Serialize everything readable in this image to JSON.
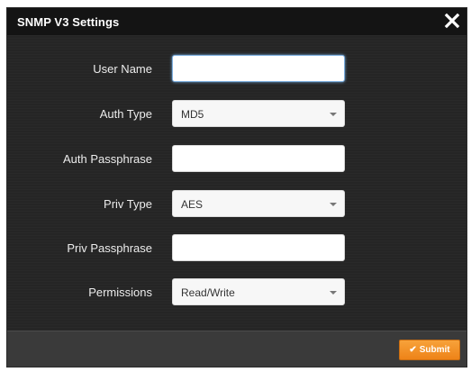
{
  "dialog": {
    "title": "SNMP V3 Settings",
    "close_icon": "close-icon"
  },
  "form": {
    "user_name": {
      "label": "User Name",
      "value": ""
    },
    "auth_type": {
      "label": "Auth Type",
      "value": "MD5"
    },
    "auth_passphrase": {
      "label": "Auth Passphrase",
      "value": ""
    },
    "priv_type": {
      "label": "Priv Type",
      "value": "AES"
    },
    "priv_passphrase": {
      "label": "Priv Passphrase",
      "value": ""
    },
    "permissions": {
      "label": "Permissions",
      "value": "Read/Write"
    }
  },
  "footer": {
    "submit_label": "Submit",
    "submit_icon": "check-icon"
  },
  "colors": {
    "accent": "#f39a2c",
    "dialog_bg": "#252525",
    "titlebar_bg": "#141414",
    "footer_bg": "#3a3a3a",
    "focus_border": "#7fb0e0"
  }
}
